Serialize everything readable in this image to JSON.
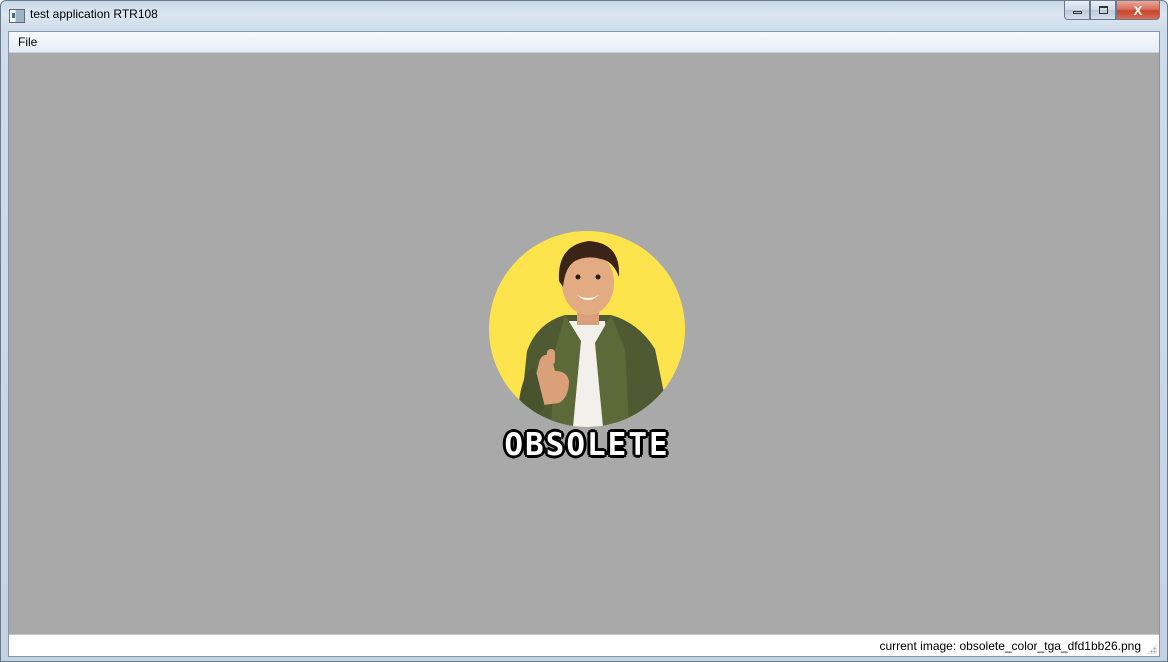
{
  "window": {
    "title": "test application RTR108",
    "controls": {
      "minimize_icon": "minimize-icon",
      "maximize_icon": "maximize-icon",
      "close_label": "X"
    }
  },
  "menubar": {
    "items": [
      {
        "label": "File"
      }
    ]
  },
  "canvas": {
    "image_text": "OBSOLETE",
    "background_color": "#a9a9a9",
    "badge_color": "#fde34c"
  },
  "statusbar": {
    "text": "current image: obsolete_color_tga_dfd1bb26.png"
  }
}
